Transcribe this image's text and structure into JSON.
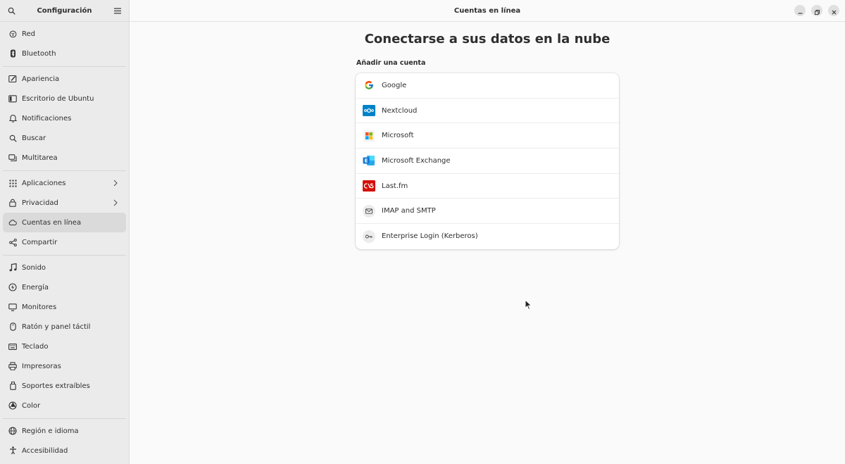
{
  "sidebar": {
    "title": "Configuración",
    "items": [
      {
        "label": "Red",
        "icon": "network-icon"
      },
      {
        "label": "Bluetooth",
        "icon": "bluetooth-icon"
      },
      {
        "label": "Apariencia",
        "icon": "appearance-icon"
      },
      {
        "label": "Escritorio de Ubuntu",
        "icon": "desktop-icon"
      },
      {
        "label": "Notificaciones",
        "icon": "bell-icon"
      },
      {
        "label": "Buscar",
        "icon": "search-icon"
      },
      {
        "label": "Multitarea",
        "icon": "multitask-icon"
      },
      {
        "label": "Aplicaciones",
        "icon": "apps-grid-icon"
      },
      {
        "label": "Privacidad",
        "icon": "lock-icon"
      },
      {
        "label": "Cuentas en línea",
        "icon": "cloud-icon"
      },
      {
        "label": "Compartir",
        "icon": "share-icon"
      },
      {
        "label": "Sonido",
        "icon": "music-note-icon"
      },
      {
        "label": "Energía",
        "icon": "power-icon"
      },
      {
        "label": "Monitores",
        "icon": "monitor-icon"
      },
      {
        "label": "Ratón y panel táctil",
        "icon": "mouse-icon"
      },
      {
        "label": "Teclado",
        "icon": "keyboard-icon"
      },
      {
        "label": "Impresoras",
        "icon": "printer-icon"
      },
      {
        "label": "Soportes extraíbles",
        "icon": "removable-media-icon"
      },
      {
        "label": "Color",
        "icon": "color-icon"
      },
      {
        "label": "Región e idioma",
        "icon": "globe-icon"
      },
      {
        "label": "Accesibilidad",
        "icon": "accessibility-icon"
      }
    ]
  },
  "header": {
    "title": "Cuentas en línea"
  },
  "main": {
    "page_title": "Conectarse a sus datos en la nube",
    "section_label": "Añadir una cuenta",
    "providers": [
      {
        "label": "Google",
        "icon": "google-icon"
      },
      {
        "label": "Nextcloud",
        "icon": "nextcloud-icon"
      },
      {
        "label": "Microsoft",
        "icon": "microsoft-icon"
      },
      {
        "label": "Microsoft Exchange",
        "icon": "exchange-icon"
      },
      {
        "label": "Last.fm",
        "icon": "lastfm-icon"
      },
      {
        "label": "IMAP and SMTP",
        "icon": "mail-icon"
      },
      {
        "label": "Enterprise Login (Kerberos)",
        "icon": "key-icon"
      }
    ]
  },
  "colors": {
    "sidebar_bg": "#ebebeb",
    "active_bg": "#dadada",
    "content_bg": "#fafafa",
    "nextcloud": "#0082c9",
    "exchange": "#0f78d4",
    "lastfm": "#d51007"
  }
}
